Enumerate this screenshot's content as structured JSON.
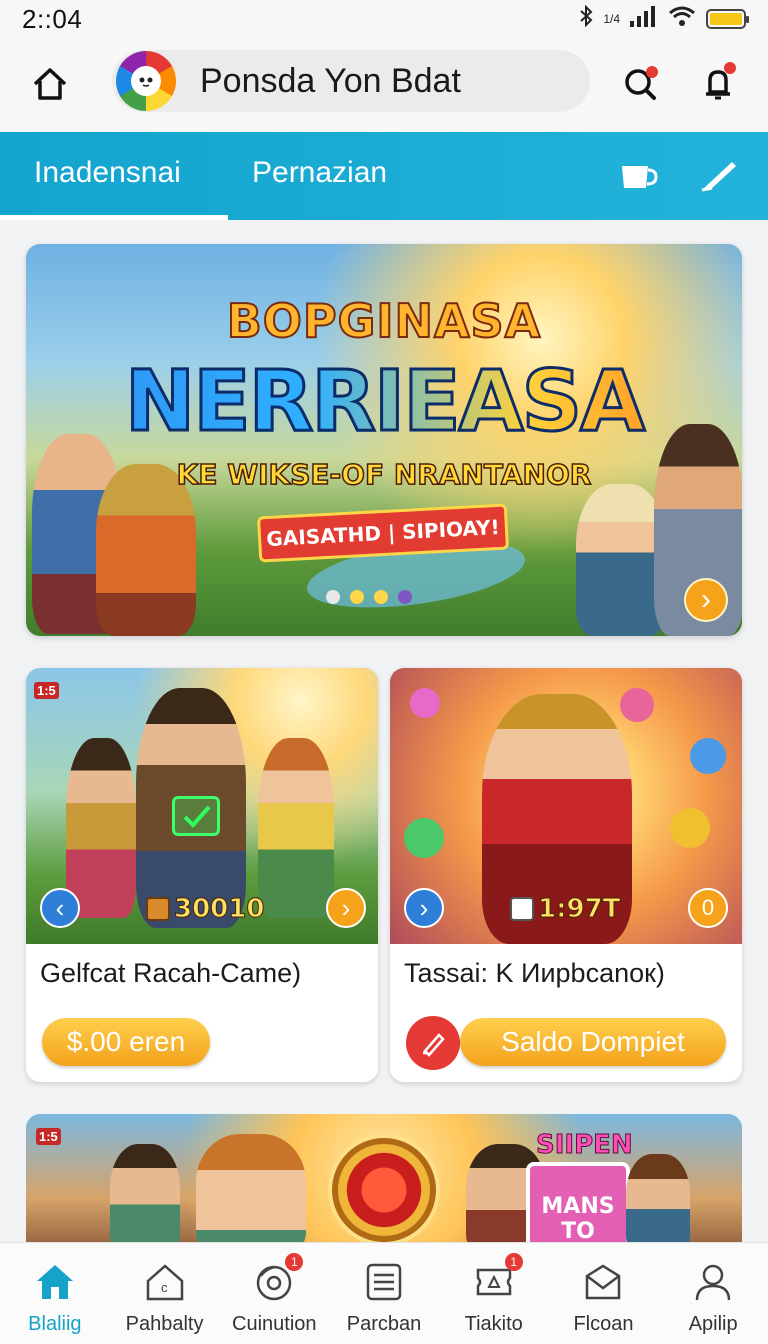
{
  "status_bar": {
    "time": "2::04",
    "network_label": "1/4",
    "icons": [
      "bluetooth-icon",
      "signal-icon",
      "wifi-icon",
      "battery-icon"
    ],
    "battery_color": "#f5c518"
  },
  "app_bar": {
    "title": "Ponsda Yon Bdat",
    "home_icon": "home-icon",
    "search_icon": "search-icon",
    "notification_icon": "notification-icon"
  },
  "tabs": {
    "items": [
      {
        "label": "Inadensnai",
        "active": true
      },
      {
        "label": "Pernazian",
        "active": false
      }
    ],
    "icons": [
      "cup-icon",
      "pen-icon"
    ],
    "bar_color": "#13a4cf"
  },
  "hero": {
    "title_top": "BOPGINASA",
    "title_main": "NERRIEASA",
    "subtitle": "KE WIKSE-OF NRANTANOR",
    "cta": "GAISATHD | SIPIOAY!",
    "dots": [
      "#e8e8e8",
      "#ffd54a",
      "#ffd54a",
      "#7e57c2"
    ],
    "next_icon": "chevron-right-icon"
  },
  "cards": [
    {
      "tag": "1:5",
      "stat": "30010",
      "title": "Gelfcat Racah-Came)",
      "button": "$.00 eren",
      "prev_icon": "chevron-left-icon",
      "next_icon": "chevron-right-icon"
    },
    {
      "stat": "1:97T",
      "badge_value": "0",
      "title": "Tassai: K Ииpbcanoк)",
      "button": "Saldo Dompiet",
      "action_icon": "pencil-icon",
      "next_icon": "chevron-right-icon"
    }
  ],
  "promo": {
    "tag": "1:5",
    "sign_top": "SIIPEN",
    "sign_main": "MANS TO"
  },
  "bottom_nav": {
    "items": [
      {
        "label": "Blaliig",
        "icon": "home-icon",
        "active": true
      },
      {
        "label": "Pahbalty",
        "icon": "house-outline-icon",
        "active": false
      },
      {
        "label": "Cuinution",
        "icon": "disc-icon",
        "active": false,
        "badge": "1"
      },
      {
        "label": "Parcban",
        "icon": "list-icon",
        "active": false
      },
      {
        "label": "Tiakito",
        "icon": "ticket-icon",
        "active": false,
        "badge": "1"
      },
      {
        "label": "Flcoan",
        "icon": "mail-icon",
        "active": false
      },
      {
        "label": "Apilip",
        "icon": "user-icon",
        "active": false
      }
    ],
    "active_color": "#17a3c8"
  }
}
